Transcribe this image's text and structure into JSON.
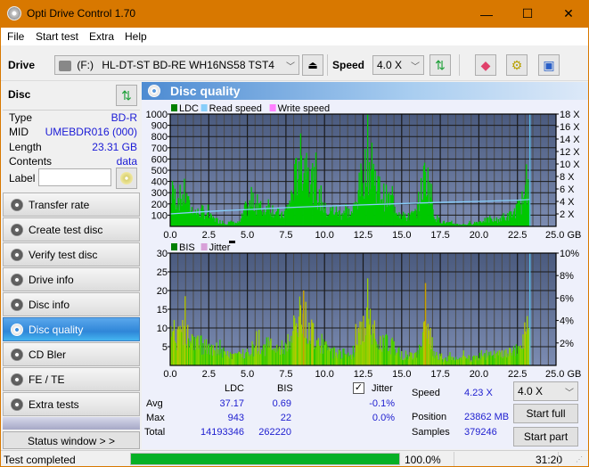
{
  "window": {
    "title": "Opti Drive Control 1.70",
    "minimize": "—",
    "maximize": "☐",
    "close": "✕"
  },
  "menu": [
    "File",
    "Start test",
    "Extra",
    "Help"
  ],
  "toolbar": {
    "drive_label": "Drive",
    "drive_letter": "(F:)",
    "drive_value": "HL-DT-ST BD-RE  WH16NS58 TST4",
    "speed_label": "Speed",
    "speed_value": "4.0 X"
  },
  "disc": {
    "title": "Disc",
    "rows": [
      {
        "label": "Type",
        "value": "BD-R"
      },
      {
        "label": "MID",
        "value": "UMEBDR016 (000)"
      },
      {
        "label": "Length",
        "value": "23.31 GB"
      },
      {
        "label": "Contents",
        "value": "data"
      }
    ],
    "label_field": {
      "label": "Label",
      "value": ""
    }
  },
  "nav": [
    {
      "label": "Transfer rate",
      "active": false
    },
    {
      "label": "Create test disc",
      "active": false
    },
    {
      "label": "Verify test disc",
      "active": false
    },
    {
      "label": "Drive info",
      "active": false
    },
    {
      "label": "Disc info",
      "active": false
    },
    {
      "label": "Disc quality",
      "active": true
    },
    {
      "label": "CD Bler",
      "active": false
    },
    {
      "label": "FE / TE",
      "active": false
    },
    {
      "label": "Extra tests",
      "active": false
    }
  ],
  "status_window_button": "Status window > >",
  "panel_title": "Disc quality",
  "chart_data": [
    {
      "type": "area",
      "title": "LDC / Read speed",
      "legend": [
        "LDC",
        "Read speed",
        "Write speed"
      ],
      "legend_colors": [
        "#008000",
        "#87cefa",
        "#ff80ff"
      ],
      "x_ticks": [
        "0.0",
        "2.5",
        "5.0",
        "7.5",
        "10.0",
        "12.5",
        "15.0",
        "17.5",
        "20.0",
        "22.5",
        "25.0 GB"
      ],
      "xlim": [
        0,
        25
      ],
      "y_ticks": [
        "100",
        "200",
        "300",
        "400",
        "500",
        "600",
        "700",
        "800",
        "900",
        "1000"
      ],
      "ylim": [
        0,
        1000
      ],
      "y2_ticks": [
        "2 X",
        "4 X",
        "6 X",
        "8 X",
        "10 X",
        "12 X",
        "14 X",
        "16 X",
        "18 X"
      ],
      "y2lim": [
        0,
        18
      ],
      "grid": true,
      "ldc_profile": [
        [
          0.0,
          300
        ],
        [
          0.3,
          290
        ],
        [
          0.6,
          280
        ],
        [
          0.9,
          320
        ],
        [
          1.2,
          190
        ],
        [
          1.5,
          150
        ],
        [
          1.8,
          130
        ],
        [
          2.1,
          150
        ],
        [
          2.4,
          100
        ],
        [
          2.7,
          80
        ],
        [
          3.0,
          60
        ],
        [
          3.3,
          40
        ],
        [
          3.6,
          30
        ],
        [
          3.9,
          40
        ],
        [
          4.2,
          30
        ],
        [
          4.5,
          40
        ],
        [
          4.8,
          160
        ],
        [
          5.1,
          200
        ],
        [
          5.4,
          230
        ],
        [
          5.7,
          200
        ],
        [
          6.0,
          150
        ],
        [
          6.3,
          220
        ],
        [
          6.6,
          170
        ],
        [
          6.9,
          130
        ],
        [
          7.2,
          100
        ],
        [
          7.5,
          160
        ],
        [
          7.8,
          280
        ],
        [
          8.1,
          480
        ],
        [
          8.4,
          620
        ],
        [
          8.7,
          660
        ],
        [
          9.0,
          560
        ],
        [
          9.3,
          390
        ],
        [
          9.6,
          260
        ],
        [
          9.9,
          180
        ],
        [
          10.2,
          130
        ],
        [
          10.5,
          160
        ],
        [
          10.8,
          140
        ],
        [
          11.1,
          110
        ],
        [
          11.4,
          150
        ],
        [
          11.7,
          120
        ],
        [
          12.0,
          220
        ],
        [
          12.3,
          420
        ],
        [
          12.6,
          560
        ],
        [
          12.9,
          600
        ],
        [
          13.2,
          500
        ],
        [
          13.5,
          360
        ],
        [
          13.8,
          300
        ],
        [
          14.1,
          260
        ],
        [
          14.4,
          240
        ],
        [
          14.7,
          160
        ],
        [
          15.0,
          100
        ],
        [
          15.3,
          80
        ],
        [
          15.6,
          110
        ],
        [
          15.9,
          130
        ],
        [
          16.2,
          320
        ],
        [
          16.5,
          520
        ],
        [
          16.8,
          380
        ],
        [
          17.1,
          100
        ],
        [
          17.4,
          60
        ],
        [
          17.7,
          40
        ],
        [
          18.0,
          30
        ],
        [
          18.3,
          30
        ],
        [
          18.6,
          20
        ],
        [
          18.9,
          20
        ],
        [
          19.2,
          20
        ],
        [
          19.5,
          30
        ],
        [
          19.8,
          40
        ],
        [
          20.1,
          50
        ],
        [
          20.4,
          60
        ],
        [
          20.7,
          60
        ],
        [
          21.0,
          60
        ],
        [
          21.3,
          70
        ],
        [
          21.6,
          80
        ],
        [
          21.9,
          100
        ],
        [
          22.2,
          130
        ],
        [
          22.5,
          180
        ],
        [
          22.8,
          250
        ],
        [
          23.1,
          300
        ],
        [
          23.3,
          330
        ]
      ],
      "read_speed_profile": [
        [
          0.0,
          2.0
        ],
        [
          2.5,
          2.4
        ],
        [
          5.0,
          2.7
        ],
        [
          7.5,
          3.0
        ],
        [
          10.0,
          3.25
        ],
        [
          12.5,
          3.45
        ],
        [
          15.0,
          3.65
        ],
        [
          17.5,
          3.85
        ],
        [
          20.0,
          4.0
        ],
        [
          22.5,
          4.2
        ],
        [
          23.3,
          4.3
        ]
      ]
    },
    {
      "type": "area",
      "title": "BIS / Jitter",
      "legend": [
        "BIS",
        "Jitter"
      ],
      "legend_colors": [
        "#008000",
        "#d8a0d8"
      ],
      "x_ticks": [
        "0.0",
        "2.5",
        "5.0",
        "7.5",
        "10.0",
        "12.5",
        "15.0",
        "17.5",
        "20.0",
        "22.5",
        "25.0 GB"
      ],
      "xlim": [
        0,
        25
      ],
      "y_ticks": [
        "5",
        "10",
        "15",
        "20",
        "25",
        "30"
      ],
      "ylim": [
        0,
        30
      ],
      "y2_ticks": [
        "2%",
        "4%",
        "6%",
        "8%",
        "10%"
      ],
      "y2lim": [
        0,
        10
      ],
      "grid": true,
      "bis_profile": [
        [
          0.0,
          10
        ],
        [
          0.3,
          9
        ],
        [
          0.6,
          8
        ],
        [
          0.9,
          11
        ],
        [
          1.2,
          7
        ],
        [
          1.5,
          6
        ],
        [
          1.8,
          7
        ],
        [
          2.1,
          6
        ],
        [
          2.4,
          5
        ],
        [
          2.7,
          4
        ],
        [
          3.0,
          5
        ],
        [
          3.3,
          4
        ],
        [
          3.6,
          3
        ],
        [
          3.9,
          3
        ],
        [
          4.2,
          3
        ],
        [
          4.5,
          3
        ],
        [
          4.8,
          4
        ],
        [
          5.1,
          5
        ],
        [
          5.4,
          5
        ],
        [
          5.7,
          5
        ],
        [
          6.0,
          5
        ],
        [
          6.3,
          6
        ],
        [
          6.6,
          5
        ],
        [
          6.9,
          5
        ],
        [
          7.2,
          5
        ],
        [
          7.5,
          6
        ],
        [
          7.8,
          8
        ],
        [
          8.1,
          12
        ],
        [
          8.4,
          14
        ],
        [
          8.7,
          13
        ],
        [
          9.0,
          11
        ],
        [
          9.3,
          9
        ],
        [
          9.6,
          7
        ],
        [
          9.9,
          6
        ],
        [
          10.2,
          4
        ],
        [
          10.5,
          4
        ],
        [
          10.8,
          4
        ],
        [
          11.1,
          3
        ],
        [
          11.4,
          3
        ],
        [
          11.7,
          3
        ],
        [
          12.0,
          6
        ],
        [
          12.3,
          10
        ],
        [
          12.6,
          12
        ],
        [
          12.9,
          12
        ],
        [
          13.2,
          10
        ],
        [
          13.5,
          8
        ],
        [
          13.8,
          7
        ],
        [
          14.1,
          6
        ],
        [
          14.4,
          7
        ],
        [
          14.7,
          4
        ],
        [
          15.0,
          3
        ],
        [
          15.3,
          3
        ],
        [
          15.6,
          3
        ],
        [
          15.9,
          4
        ],
        [
          16.2,
          7
        ],
        [
          16.5,
          10
        ],
        [
          16.8,
          8
        ],
        [
          17.1,
          4
        ],
        [
          17.4,
          3
        ],
        [
          17.7,
          2
        ],
        [
          18.0,
          2
        ],
        [
          18.3,
          2
        ],
        [
          18.6,
          2
        ],
        [
          18.9,
          2
        ],
        [
          19.2,
          2
        ],
        [
          19.5,
          2
        ],
        [
          19.8,
          2
        ],
        [
          20.1,
          3
        ],
        [
          20.4,
          3
        ],
        [
          20.7,
          3
        ],
        [
          21.0,
          3
        ],
        [
          21.3,
          3
        ],
        [
          21.6,
          3
        ],
        [
          21.9,
          4
        ],
        [
          22.2,
          4
        ],
        [
          22.5,
          5
        ],
        [
          22.8,
          8
        ],
        [
          23.1,
          10
        ],
        [
          23.3,
          11
        ]
      ],
      "spikes": [
        [
          8.6,
          20
        ],
        [
          16.5,
          22
        ]
      ]
    }
  ],
  "stats": {
    "col_ldc": "LDC",
    "col_bis": "BIS",
    "jitter_label": "Jitter",
    "jitter_checked": true,
    "rows": [
      {
        "label": "Avg",
        "ldc": "37.17",
        "bis": "0.69",
        "jitter": "-0.1%"
      },
      {
        "label": "Max",
        "ldc": "943",
        "bis": "22",
        "jitter": "0.0%"
      },
      {
        "label": "Total",
        "ldc": "14193346",
        "bis": "262220",
        "jitter": ""
      }
    ],
    "speed_label": "Speed",
    "speed_value": "4.23 X",
    "position_label": "Position",
    "position_value": "23862 MB",
    "samples_label": "Samples",
    "samples_value": "379246",
    "speed_select": "4.0 X",
    "start_full": "Start full",
    "start_part": "Start part"
  },
  "status": {
    "text": "Test completed",
    "progress": 100.0,
    "progress_label": "100.0%",
    "time": "31:20"
  }
}
